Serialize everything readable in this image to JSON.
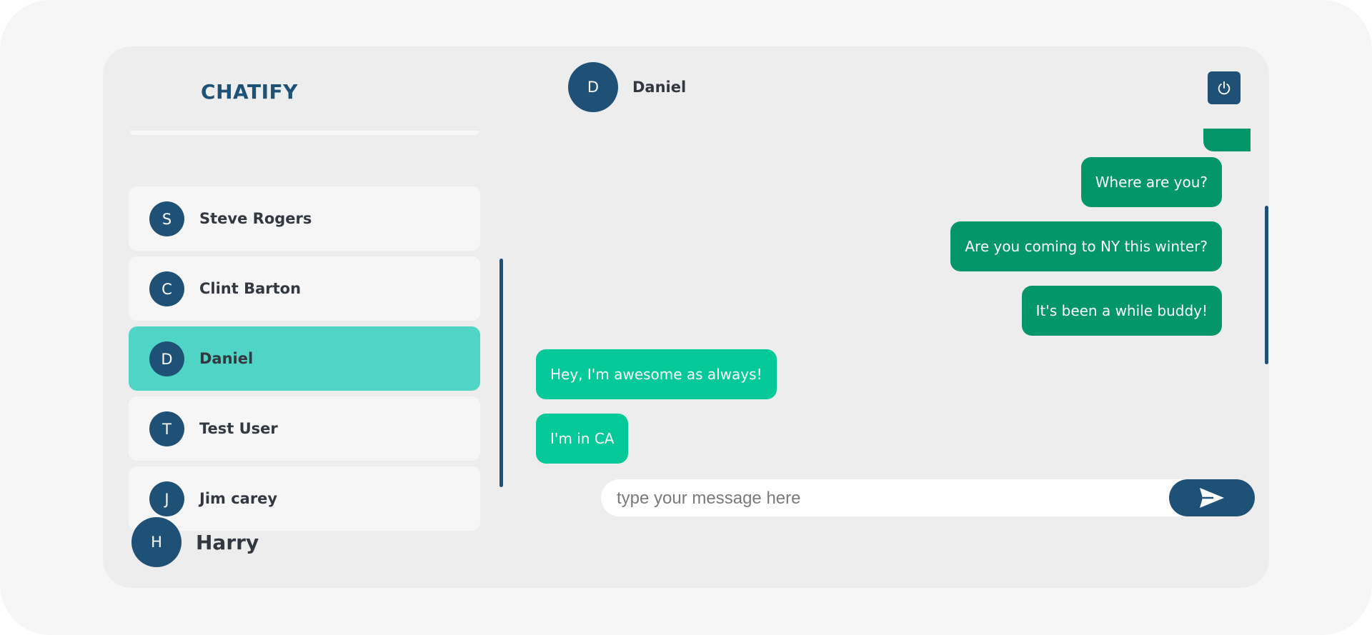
{
  "app": {
    "brand": "CHATIFY"
  },
  "contacts": [
    {
      "initial": "S",
      "name": "Steve Rogers",
      "active": false
    },
    {
      "initial": "C",
      "name": "Clint Barton",
      "active": false
    },
    {
      "initial": "D",
      "name": "Daniel",
      "active": true
    },
    {
      "initial": "T",
      "name": "Test User",
      "active": false
    },
    {
      "initial": "J",
      "name": "Jim carey",
      "active": false
    }
  ],
  "current_user": {
    "initial": "H",
    "name": "Harry"
  },
  "chat": {
    "partner_initial": "D",
    "partner_name": "Daniel",
    "messages": [
      {
        "direction": "sent",
        "text": "Where are you?"
      },
      {
        "direction": "sent",
        "text": "Are you coming to NY this winter?"
      },
      {
        "direction": "sent",
        "text": "It's been a while buddy!"
      },
      {
        "direction": "received",
        "text": "Hey, I'm awesome as always!"
      },
      {
        "direction": "received",
        "text": "I'm in CA"
      }
    ]
  },
  "composer": {
    "placeholder": "type your message here"
  },
  "icons": {
    "logout": "power-icon",
    "send": "send-icon"
  },
  "colors": {
    "brand_blue": "#1f5177",
    "active_contact": "#50d4c6",
    "sent_bubble": "#039669",
    "received_bubble": "#05c998"
  }
}
